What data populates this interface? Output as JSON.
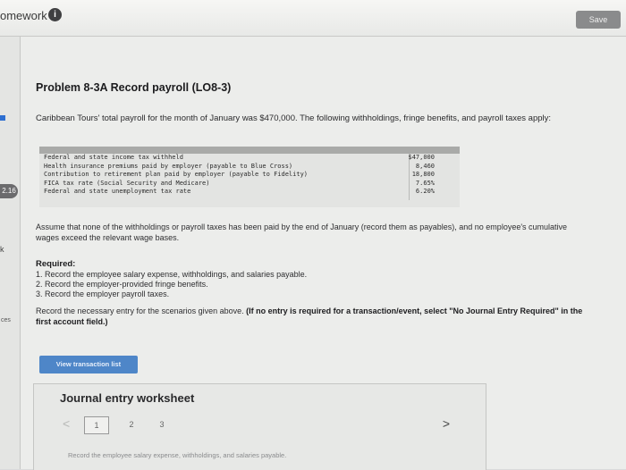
{
  "app": {
    "title": "omework",
    "save_label": "Save"
  },
  "rail": {
    "badge": "2.16",
    "label": "ces",
    "tick": "k"
  },
  "problem": {
    "title": "Problem 8-3A Record payroll (LO8-3)",
    "intro": "Caribbean Tours' total payroll for the month of January was $470,000. The following withholdings, fringe benefits, and payroll taxes apply:"
  },
  "rates": [
    {
      "desc": "Federal and state income tax withheld",
      "value": "$47,000"
    },
    {
      "desc": "Health insurance premiums paid by employer (payable to Blue Cross)",
      "value": "8,460"
    },
    {
      "desc": "Contribution to retirement plan paid by employer (payable to Fidelity)",
      "value": "18,800"
    },
    {
      "desc": "FICA tax rate (Social Security and Medicare)",
      "value": "7.65%"
    },
    {
      "desc": "Federal and state unemployment tax rate",
      "value": "6.20%"
    }
  ],
  "assume": "Assume that none of the withholdings or payroll taxes has been paid by the end of January (record them as payables), and no employee's cumulative wages exceed the relevant wage bases.",
  "required": {
    "heading": "Required:",
    "items": [
      "1. Record the employee salary expense, withholdings, and salaries payable.",
      "2. Record the employer-provided fringe benefits.",
      "3. Record the employer payroll taxes."
    ]
  },
  "record_note": {
    "prefix": "Record the necessary entry for the scenarios given above.",
    "bold": "(If no entry is required for a transaction/event, select \"No Journal Entry Required\" in the first account field.)"
  },
  "view_button": "View transaction list",
  "worksheet": {
    "title": "Journal entry worksheet",
    "pages": [
      "1",
      "2",
      "3"
    ],
    "current_page": "1",
    "prev": "<",
    "next": ">",
    "instruction": "Record the employee salary expense, withholdings, and salaries payable."
  }
}
